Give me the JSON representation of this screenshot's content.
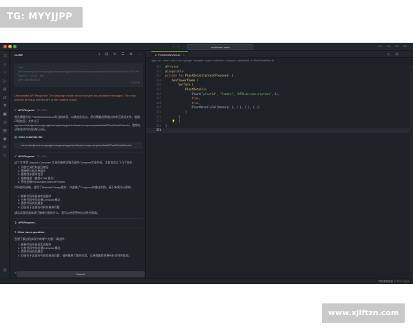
{
  "watermarks": {
    "top_left": "TG: MYYJJPP",
    "bottom_right": "www.xjlftzn.com"
  },
  "titlebar": {
    "nav": "← →",
    "search": "sunflower-main",
    "icons": "▭ ▭ ▭ ▭"
  },
  "activity_icons": [
    "files-icon",
    "search-icon",
    "source-control-icon",
    "run-debug-icon",
    "extensions-icon",
    "remote-icon",
    "test-icon",
    "docker-icon",
    "timeline-icon",
    "book-icon",
    "gitlens-icon",
    "chat-icon",
    "cline-icon"
  ],
  "sidebar": {
    "title": "CLINE",
    "actions": "+ ⊟ ↻ ☰ ⚙ ⋯",
    "task": {
      "label": "Task",
      "line1": "@/src/main/java/com/google/samples/apps/sunflower/compose/plantdetail/PlantDetailView.kt 中 PlantDetailContentPreview 有什么用？",
      "line2": "Tokens: ↑ 11.4k ↓ 661",
      "line3": "API Cost: $0.0517",
      "size": "314 kB"
    },
    "error": "Unexpected API Response: The language model did not provide any assistant messages. This may indicate an issue with the API or the model's output.",
    "api_request_1": {
      "label": "API Request",
      "cost": "$0.0354"
    },
    "para1": "首先需要分析 PlantDetailView.kt 的当前实现，以确定优化点。然后需要创建相应的单元测试文件。根据环境信息，文件位于 app/src/main/java/com/google/samples/apps/sunflower/compose/plantdetail/PlantDetailView.kt，我将先读取该文件内容进行分析。",
    "read_label": "Cline read this file:",
    "file_path": "…/src/main/java/com/google/samples/apps/sunflower/compose/plantdetail/PlantDetailView.kt",
    "api_request_2": {
      "label": "API Request",
      "cost": "$0.0069"
    },
    "para2": "这个文件是 Jetpack Compose 实现的植物详情页面的Compose实现代码。主要包含以下几个部分：",
    "list1": [
      "1. 顶部工具栏和返回按钮",
      "2. 植物图片和名称展示",
      "3. 植物浇水要求信息",
      "4. 植物描述（使用HTML格式）",
      "5. 预览函数PlantDetailContentPreview"
    ],
    "para3": "代码结构清晰，使用了Material Design组件，并遵循了Compose的最佳实践。接下来我可以帮助：",
    "list2": [
      "1. 解释代码的具体实现细节",
      "2. 分析代码中的关键Compose概念",
      "3. 提供代码优化建议",
      "4. 回答关于这部分代码的具体问题"
    ],
    "para4": "请告诉我您具体想了解哪方面的什么，我可以给您更有针对性的帮助。",
    "api_request_3": {
      "label": "API Request…"
    },
    "question_label": "Cline has a question:",
    "para5": "您想了解这段实现中的哪个方面？请选择：",
    "list3": [
      "1. 解释代码的具体实现细节",
      "2. 分析代码中的关键Compose概念",
      "3. 提供代码优化建议",
      "4. 回答关于这部分代码的具体问题，请将最想了解的内容，以便我能提供更有针对性的帮助。"
    ],
    "auto_approve": "Auto-approve: Read, Edit, Commands, Browser, MCP",
    "cancel": "Cancel"
  },
  "editor": {
    "tab": {
      "label": "PlantDetailView.kt",
      "kind_letter": "K",
      "close": "×"
    },
    "actions": "▷ ⊟ ⋯",
    "breadcrumbs": "app › src › main › java › com › google › samples › apps › sunflower › compose › plantdetail › K PlantDetailView.kt",
    "lines": [
      {
        "n": "360",
        "parts": [
          {
            "c": "an",
            "t": "@Preview"
          }
        ]
      },
      {
        "n": "361",
        "parts": [
          {
            "c": "an",
            "t": "@Composable"
          }
        ]
      },
      {
        "n": "362",
        "parts": [
          {
            "c": "kw",
            "t": "private fun "
          },
          {
            "c": "fn",
            "t": "PlantDetailContentPreview"
          },
          {
            "c": "tx",
            "t": "() {"
          }
        ]
      },
      {
        "n": "363",
        "parts": [
          {
            "c": "tx",
            "t": "    "
          },
          {
            "c": "fn",
            "t": "SunflowerTheme"
          },
          {
            "c": "tx",
            "t": " {"
          }
        ]
      },
      {
        "n": "364",
        "parts": [
          {
            "c": "tx",
            "t": "        "
          },
          {
            "c": "fn",
            "t": "Surface"
          },
          {
            "c": "tx",
            "t": " {"
          }
        ]
      },
      {
        "n": "365",
        "parts": [
          {
            "c": "tx",
            "t": "            "
          },
          {
            "c": "fn",
            "t": "PlantDetails"
          },
          {
            "c": "tx",
            "t": "("
          }
        ]
      },
      {
        "n": "366",
        "parts": [
          {
            "c": "tx",
            "t": "                Plant("
          },
          {
            "c": "st",
            "t": "\"plantId\""
          },
          {
            "c": "tx",
            "t": ", "
          },
          {
            "c": "st",
            "t": "\"Tomato\""
          },
          {
            "c": "tx",
            "t": ", "
          },
          {
            "c": "st",
            "t": "\"HTML<br>description\""
          },
          {
            "c": "tx",
            "t": ", 6),"
          }
        ]
      },
      {
        "n": "367",
        "parts": [
          {
            "c": "tx",
            "t": "                "
          },
          {
            "c": "kw",
            "t": "true"
          },
          {
            "c": "tx",
            "t": ","
          }
        ]
      },
      {
        "n": "368",
        "parts": [
          {
            "c": "tx",
            "t": "                "
          },
          {
            "c": "kw",
            "t": "true"
          },
          {
            "c": "tx",
            "t": ","
          }
        ]
      },
      {
        "n": "369",
        "parts": [
          {
            "c": "tx",
            "t": "                PlantDetailsCallbacks({ }, { }, { }, { })"
          }
        ]
      },
      {
        "n": "370",
        "parts": [
          {
            "c": "tx",
            "t": "            )"
          }
        ]
      },
      {
        "n": "371",
        "parts": [
          {
            "c": "tx",
            "t": "        }"
          }
        ]
      },
      {
        "n": "372",
        "parts": [
          {
            "c": "bulb",
            "t": "    💡"
          },
          {
            "c": "tx",
            "t": "  }"
          }
        ]
      },
      {
        "n": "373",
        "parts": [
          {
            "c": "tx",
            "t": "}"
          }
        ]
      },
      {
        "n": "374",
        "parts": [
          {
            "c": "tx",
            "t": ""
          }
        ],
        "highlight": true
      }
    ]
  },
  "statusbar": {
    "right": "同多语系统区 ⓘ 0 ⓧ 1 ⚠ 0"
  }
}
